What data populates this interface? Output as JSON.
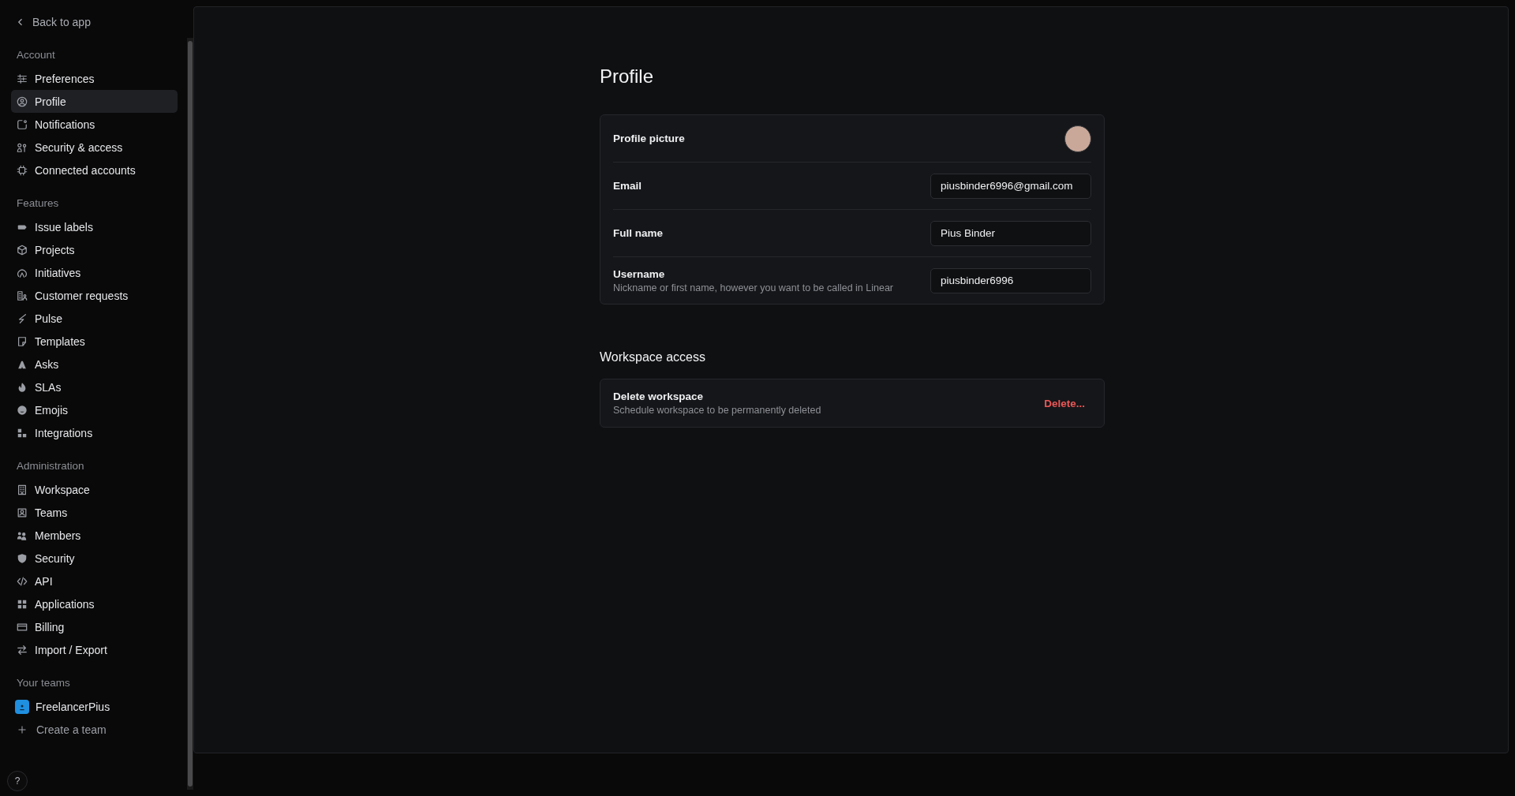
{
  "back_link": "Back to app",
  "sidebar": {
    "sections": [
      {
        "title": "Account",
        "items": [
          {
            "label": "Preferences",
            "selected": false
          },
          {
            "label": "Profile",
            "selected": true
          },
          {
            "label": "Notifications",
            "selected": false
          },
          {
            "label": "Security & access",
            "selected": false
          },
          {
            "label": "Connected accounts",
            "selected": false
          }
        ]
      },
      {
        "title": "Features",
        "items": [
          {
            "label": "Issue labels",
            "selected": false
          },
          {
            "label": "Projects",
            "selected": false
          },
          {
            "label": "Initiatives",
            "selected": false
          },
          {
            "label": "Customer requests",
            "selected": false
          },
          {
            "label": "Pulse",
            "selected": false
          },
          {
            "label": "Templates",
            "selected": false
          },
          {
            "label": "Asks",
            "selected": false
          },
          {
            "label": "SLAs",
            "selected": false
          },
          {
            "label": "Emojis",
            "selected": false
          },
          {
            "label": "Integrations",
            "selected": false
          }
        ]
      },
      {
        "title": "Administration",
        "items": [
          {
            "label": "Workspace",
            "selected": false
          },
          {
            "label": "Teams",
            "selected": false
          },
          {
            "label": "Members",
            "selected": false
          },
          {
            "label": "Security",
            "selected": false
          },
          {
            "label": "API",
            "selected": false
          },
          {
            "label": "Applications",
            "selected": false
          },
          {
            "label": "Billing",
            "selected": false
          },
          {
            "label": "Import / Export",
            "selected": false
          }
        ]
      }
    ],
    "teams": {
      "title": "Your teams",
      "items": [
        {
          "label": "FreelancerPius",
          "color": "#1f8fe0"
        }
      ],
      "create": "Create a team"
    },
    "help": "?"
  },
  "page": {
    "title": "Profile",
    "profile_card": {
      "picture_label": "Profile picture",
      "fields": [
        {
          "label": "Email",
          "value": "piusbinder6996@gmail.com"
        },
        {
          "label": "Full name",
          "value": "Pius Binder"
        },
        {
          "label": "Username",
          "hint": "Nickname or first name, however you want to be called in Linear",
          "value": "piusbinder6996"
        }
      ]
    },
    "workspace": {
      "heading": "Workspace access",
      "items": [
        {
          "title": "Delete workspace",
          "description": "Schedule workspace to be permanently deleted",
          "action": "Delete..."
        }
      ]
    }
  }
}
